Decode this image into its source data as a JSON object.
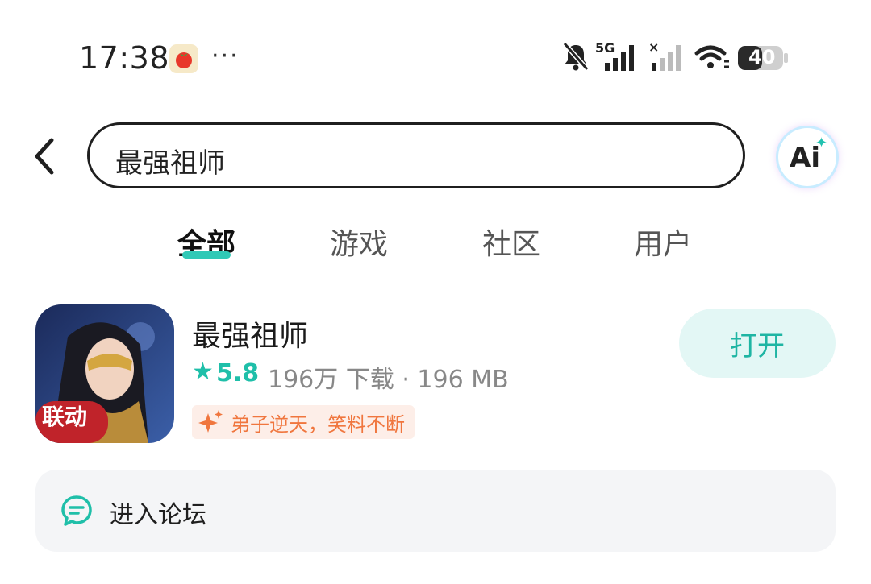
{
  "status_bar": {
    "time": "17:38",
    "notification_app_icon": "tomato-app-icon",
    "more": "···",
    "network_label": "5G",
    "battery": "40"
  },
  "search": {
    "query": "最强祖师",
    "ai_label": "Ai"
  },
  "tabs": [
    {
      "label": "全部",
      "active": true
    },
    {
      "label": "游戏",
      "active": false
    },
    {
      "label": "社区",
      "active": false
    },
    {
      "label": "用户",
      "active": false
    }
  ],
  "result": {
    "name": "最强祖师",
    "rating": "5.8",
    "meta": "196万 下载 · 196 MB",
    "tag": "弟子逆天，笑料不断",
    "icon_badge": "联动",
    "open_label": "打开"
  },
  "forum": {
    "label": "进入论坛"
  },
  "colors": {
    "accent": "#1fbfa9",
    "tag_orange": "#f0763e",
    "open_bg": "#e3f7f5"
  }
}
